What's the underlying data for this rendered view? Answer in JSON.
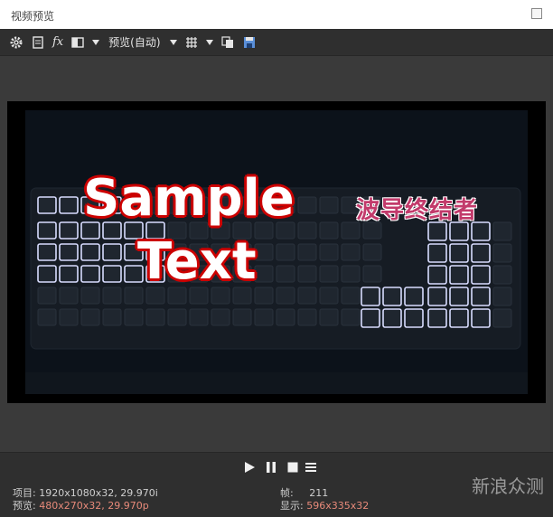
{
  "window": {
    "title": "视频预览"
  },
  "toolbar": {
    "fx_label": "fx",
    "preview_label": "预览(自动)"
  },
  "video": {
    "overlay_line1": "Sample",
    "overlay_line2": "Text",
    "overlay_cn": "波导终结者"
  },
  "status": {
    "project_label": "项目:",
    "project_value": "1920x1080x32, 29.970i",
    "preview_label": "预览:",
    "preview_value": "480x270x32, 29.970p",
    "frame_label": "帧:",
    "frame_value": "211",
    "display_label": "显示:",
    "display_value": "596x335x32"
  },
  "watermark": "新浪众测",
  "colors": {
    "toolbar_bg": "#2f2f2f",
    "highlight": "#e88a7a",
    "overlay_red": "#cc0000"
  }
}
